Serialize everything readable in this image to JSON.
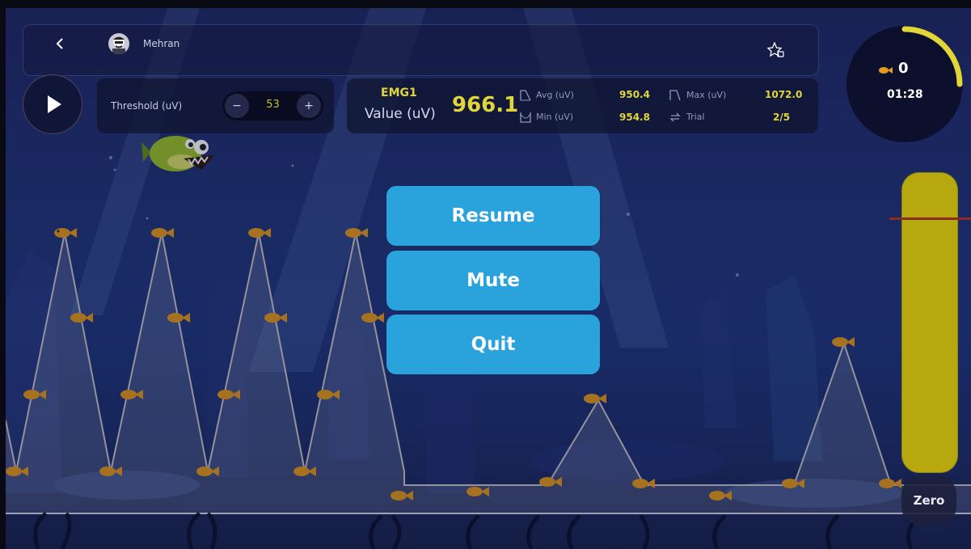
{
  "player": {
    "name": "Mehran"
  },
  "threshold": {
    "label": "Threshold (uV)",
    "value": "53",
    "minus": "−",
    "plus": "+"
  },
  "emg": {
    "channel": "EMG1",
    "value_label": "Value (uV)",
    "value": "966.1",
    "avg_label": "Avg (uV)",
    "avg": "950.4",
    "min_label": "Min (uV)",
    "min": "954.8",
    "max_label": "Max (uV)",
    "max": "1072.0",
    "trial_label": "Trial",
    "trial": "2/5"
  },
  "status": {
    "score": "0",
    "timer": "01:28"
  },
  "menu": {
    "resume": "Resume",
    "mute": "Mute",
    "quit": "Quit"
  },
  "controls": {
    "zero": "Zero"
  },
  "icons": [
    "back-arrow-icon",
    "avatar-icon",
    "star-badge-icon",
    "play-icon",
    "avg-icon",
    "min-icon",
    "max-icon",
    "trial-icon",
    "fish-icon"
  ],
  "colors": {
    "accent_yellow": "#e0d63a",
    "menu_blue": "#2aa3dd",
    "meter_fill": "#b8a80f",
    "threshold_line": "#8b2d22"
  }
}
